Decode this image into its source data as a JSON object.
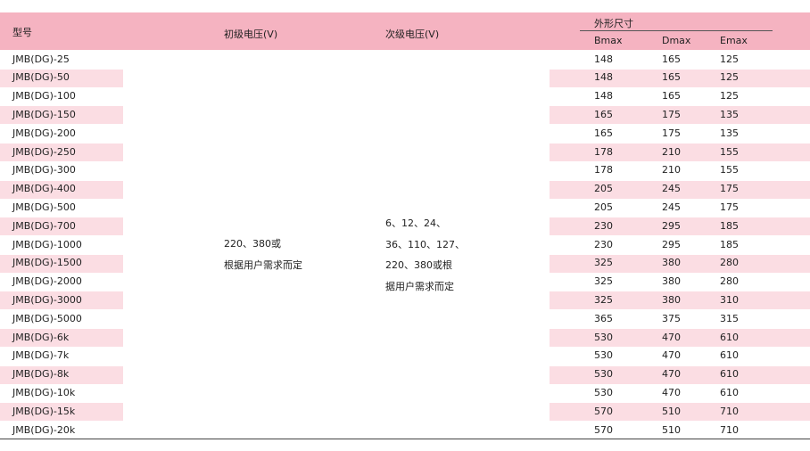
{
  "headers": {
    "model": "型号",
    "primary_voltage": "初级电压(V)",
    "secondary_voltage": "次级电压(V)",
    "dimensions": "外形尺寸",
    "bmax": "Bmax",
    "dmax": "Dmax",
    "emax": "Emax"
  },
  "primary_voltage_text": [
    "220、380或",
    "根据用户需求而定"
  ],
  "secondary_voltage_text": [
    "6、12、24、",
    "36、110、127、",
    "220、380或根",
    "据用户需求而定"
  ],
  "rows": [
    {
      "model": "JMB(DG)-25",
      "bmax": "148",
      "dmax": "165",
      "emax": "125"
    },
    {
      "model": "JMB(DG)-50",
      "bmax": "148",
      "dmax": "165",
      "emax": "125"
    },
    {
      "model": "JMB(DG)-100",
      "bmax": "148",
      "dmax": "165",
      "emax": "125"
    },
    {
      "model": "JMB(DG)-150",
      "bmax": "165",
      "dmax": "175",
      "emax": "135"
    },
    {
      "model": "JMB(DG)-200",
      "bmax": "165",
      "dmax": "175",
      "emax": "135"
    },
    {
      "model": "JMB(DG)-250",
      "bmax": "178",
      "dmax": "210",
      "emax": "155"
    },
    {
      "model": "JMB(DG)-300",
      "bmax": "178",
      "dmax": "210",
      "emax": "155"
    },
    {
      "model": "JMB(DG)-400",
      "bmax": "205",
      "dmax": "245",
      "emax": "175"
    },
    {
      "model": "JMB(DG)-500",
      "bmax": "205",
      "dmax": "245",
      "emax": "175"
    },
    {
      "model": "JMB(DG)-700",
      "bmax": "230",
      "dmax": "295",
      "emax": "185"
    },
    {
      "model": "JMB(DG)-1000",
      "bmax": "230",
      "dmax": "295",
      "emax": "185"
    },
    {
      "model": "JMB(DG)-1500",
      "bmax": "325",
      "dmax": "380",
      "emax": "280"
    },
    {
      "model": "JMB(DG)-2000",
      "bmax": "325",
      "dmax": "380",
      "emax": "280"
    },
    {
      "model": "JMB(DG)-3000",
      "bmax": "325",
      "dmax": "380",
      "emax": "310"
    },
    {
      "model": "JMB(DG)-5000",
      "bmax": "365",
      "dmax": "375",
      "emax": "315"
    },
    {
      "model": "JMB(DG)-6k",
      "bmax": "530",
      "dmax": "470",
      "emax": "610"
    },
    {
      "model": "JMB(DG)-7k",
      "bmax": "530",
      "dmax": "470",
      "emax": "610"
    },
    {
      "model": "JMB(DG)-8k",
      "bmax": "530",
      "dmax": "470",
      "emax": "610"
    },
    {
      "model": "JMB(DG)-10k",
      "bmax": "530",
      "dmax": "470",
      "emax": "610"
    },
    {
      "model": "JMB(DG)-15k",
      "bmax": "570",
      "dmax": "510",
      "emax": "710"
    },
    {
      "model": "JMB(DG)-20k",
      "bmax": "570",
      "dmax": "510",
      "emax": "710"
    }
  ],
  "colors": {
    "header_bg": "#f5b3c1",
    "stripe_bg": "#fbdde3",
    "text": "#222222"
  }
}
